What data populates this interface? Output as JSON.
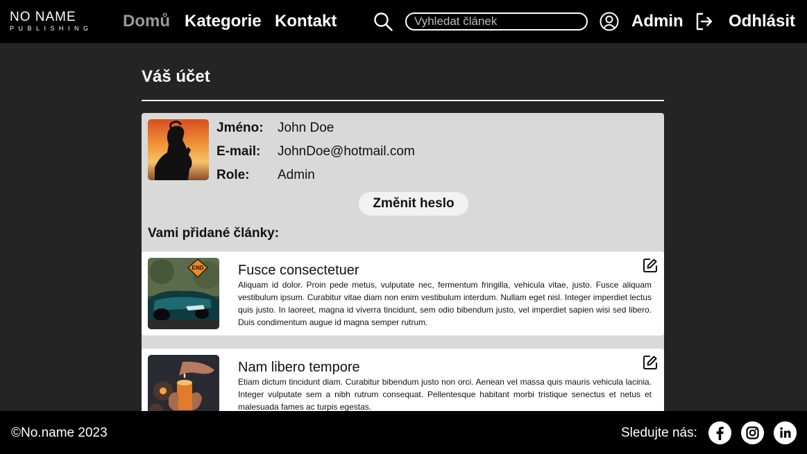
{
  "header": {
    "logo_top": "NO NAME",
    "logo_bottom": "PUBLISHING",
    "nav": [
      {
        "label": "Domů",
        "active": true
      },
      {
        "label": "Kategorie",
        "active": false
      },
      {
        "label": "Kontakt",
        "active": false
      }
    ],
    "search_placeholder": "Vyhledat článek",
    "user_label": "Admin",
    "logout_label": "Odhlásit"
  },
  "main": {
    "title": "Váš účet",
    "profile": {
      "name_label": "Jméno:",
      "name_value": "John Doe",
      "email_label": "E-mail:",
      "email_value": "JohnDoe@hotmail.com",
      "role_label": "Role:",
      "role_value": "Admin"
    },
    "change_password_label": "Změnit heslo",
    "articles_heading": "Vami přidané články:",
    "articles": [
      {
        "title": "Fusce consectetuer",
        "excerpt": "Aliquam id dolor. Proin pede metus, vulputate nec, fermentum fringilla, vehicula vitae, justo. Fusce aliquam vestibulum ipsum. Curabitur vitae diam non enim vestibulum interdum. Nullam eget nisl. Integer imperdiet lectus quis justo. In laoreet, magna id viverra tincidunt, sem odio bibendum justo, vel imperdiet sapien wisi sed libero. Duis condimentum augue id magna semper rutrum.",
        "sign_text": "END"
      },
      {
        "title": "Nam libero tempore",
        "excerpt": "Etiam dictum tincidunt diam. Curabitur bibendum justo non orci. Aenean vel massa quis mauris vehicula lacinia. Integer vulputate sem a nibh rutrum consequat. Pellentesque habitant morbi tristique senectus et netus et malesuada fames ac turpis egestas."
      }
    ]
  },
  "footer": {
    "copyright": "©No.name 2023",
    "follow_label": "Sledujte nás:",
    "social": [
      "facebook-icon",
      "instagram-icon",
      "linkedin-icon"
    ]
  },
  "colors": {
    "header_bg": "#000000",
    "page_bg": "#242424",
    "panel_bg": "#d9d9d9",
    "nav_active": "#9a9a9a"
  }
}
